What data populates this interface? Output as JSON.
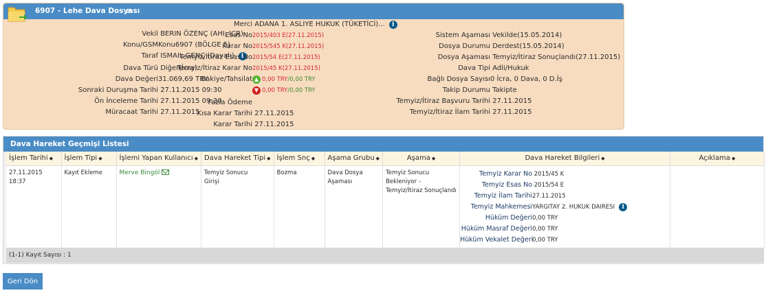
{
  "case": {
    "title": "6907 - Lehe Dava Dosyası",
    "col1": [
      {
        "label": "Vekil",
        "value": "BERIN ÖZENÇ (AHI, ICR)-"
      },
      {
        "label": "Konu/GSM",
        "value": "Konu6907 (BÖLGE 5)"
      },
      {
        "label": "Taraf",
        "value": "ISMAIL GENÇ (Davalı)"
      },
      {
        "label": "Dava Türü",
        "value": "Diğer(İcra)"
      },
      {
        "label": "Dava Değeri",
        "value": "31.069,69 TRY"
      },
      {
        "label": "Sonraki Duruşma Tarihi",
        "value": "27.11.2015 09:30"
      },
      {
        "label": "Ön İnceleme Tarihi",
        "value": "27.11.2015 09:30"
      },
      {
        "label": "Müracaat Tarihi",
        "value": "27.11.2015"
      }
    ],
    "col2": [
      {
        "label": "Merci",
        "value": "ADANA 1. ASLIYE HUKUK (TÜKETİCİ)..."
      },
      {
        "label": "Esas No",
        "value": "2015/403 E(27.11.2015)"
      },
      {
        "label": "Karar No",
        "value": "2015/545 K(27.11.2015)"
      },
      {
        "label": "Temyiz/İtiraz Esas No",
        "value": "2015/54 E(27.11.2015)"
      },
      {
        "label": "Temyiz/İtiraz Karar No",
        "value": "2015/45 K(27.11.2015)"
      },
      {
        "label": "Bakiye/Tahsilat",
        "value_a": "0,00 TRY",
        "value_b": "/0,00 TRY"
      },
      {
        "label": "",
        "value_a": "0,00 TRY",
        "value_b": "/0,00 TRY"
      },
      {
        "label": "Fazla Ödeme",
        "value": ""
      },
      {
        "label": "Kısa Karar Tarihi",
        "value": "27.11.2015"
      },
      {
        "label": "Karar Tarihi",
        "value": "27.11.2015"
      }
    ],
    "col3": [
      {
        "label": "Sistem Aşaması",
        "value": "Vekilde(15.05.2014)"
      },
      {
        "label": "Dosya Durumu",
        "value": "Derdest(15.05.2014)"
      },
      {
        "label": "Dosya Aşaması",
        "value": "Temyiz/İtiraz Sonuçlandı(27.11.2015)"
      },
      {
        "label": "Dava Tipi",
        "value": "Adli/Hukuk"
      },
      {
        "label": "Bağlı Dosya Sayısı",
        "value": "0 İcra, 0 Dava, 0 D.İş"
      },
      {
        "label": "Takip Durumu",
        "value": "Takipte"
      },
      {
        "label": "Temyiz/İtiraz Başvuru Tarihi",
        "value": "27.11.2015"
      },
      {
        "label": "Temyiz/İtiraz İlam Tarihi",
        "value": "27.11.2015"
      }
    ]
  },
  "history": {
    "title": "Dava Hareket Geçmişi Listesi",
    "columns": [
      "İşlem Tarihi",
      "İşlem Tipi",
      "İşlemi Yapan Kullanıcı",
      "Dava Hareket Tipi",
      "İşlem Snç",
      "Aşama Grubu",
      "Aşama",
      "Dava Hareket Bilgileri",
      "Açıklama"
    ],
    "row": {
      "date": "27.11.2015",
      "time": "18:37",
      "type": "Kayıt Ekleme",
      "user": "Merve Bingöl",
      "move_type_1": "Temyiz Sonucu",
      "move_type_2": "Girişi",
      "result": "Bozma",
      "stage_group_1": "Dava Dosya",
      "stage_group_2": "Aşaması",
      "stage_1": "Temyiz Sonucu",
      "stage_2": "Bekleniyor -",
      "stage_3": "Temyiz/İtiraz Sonuçlandı",
      "details": [
        {
          "label": "Temyiz Karar No",
          "value": "2015/45",
          "suffix": "K"
        },
        {
          "label": "Temyiz Esas No",
          "value": "2015/54",
          "suffix": "E"
        },
        {
          "label": "Temyiz İlam Tarihi",
          "value": "27.11.2015",
          "suffix": ""
        },
        {
          "label": "Temyiz Mahkemesi",
          "value": "YARGITAY 2. HUKUK DAIRESI",
          "suffix": ""
        },
        {
          "label": "Hüküm Değeri",
          "value": "0,00 TRY",
          "suffix": ""
        },
        {
          "label": "Hüküm Masraf Değeri",
          "value": "0,00 TRY",
          "suffix": ""
        },
        {
          "label": "Hüküm Vekalet Değeri",
          "value": "0,00 TRY",
          "suffix": ""
        }
      ]
    },
    "footer": "(1-1) Kayıt Sayısı : 1"
  },
  "back_button": "Geri Dön"
}
